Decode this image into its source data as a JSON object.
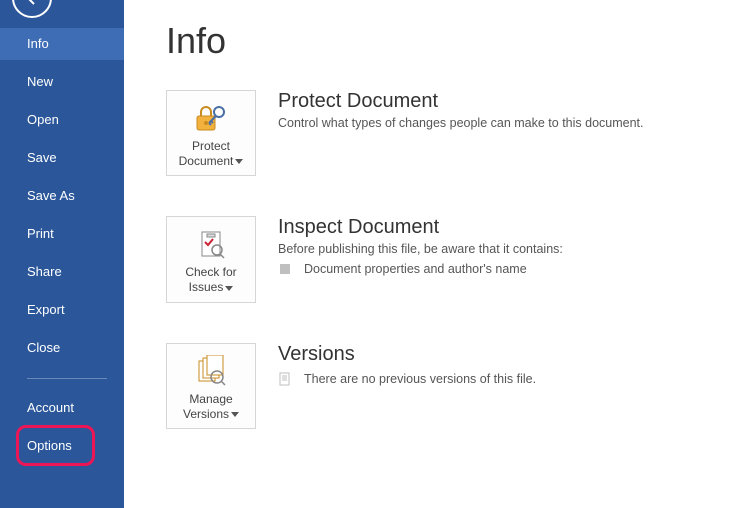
{
  "sidebar": {
    "items": [
      {
        "label": "Info"
      },
      {
        "label": "New"
      },
      {
        "label": "Open"
      },
      {
        "label": "Save"
      },
      {
        "label": "Save As"
      },
      {
        "label": "Print"
      },
      {
        "label": "Share"
      },
      {
        "label": "Export"
      },
      {
        "label": "Close"
      },
      {
        "label": "Account"
      },
      {
        "label": "Options"
      }
    ]
  },
  "main": {
    "title": "Info",
    "protect": {
      "tile_label": "Protect Document",
      "title": "Protect Document",
      "text": "Control what types of changes people can make to this document."
    },
    "inspect": {
      "tile_label": "Check for Issues",
      "title": "Inspect Document",
      "text": "Before publishing this file, be aware that it contains:",
      "bullet": "Document properties and author's name"
    },
    "versions": {
      "tile_label": "Manage Versions",
      "title": "Versions",
      "bullet": "There are no previous versions of this file."
    }
  }
}
